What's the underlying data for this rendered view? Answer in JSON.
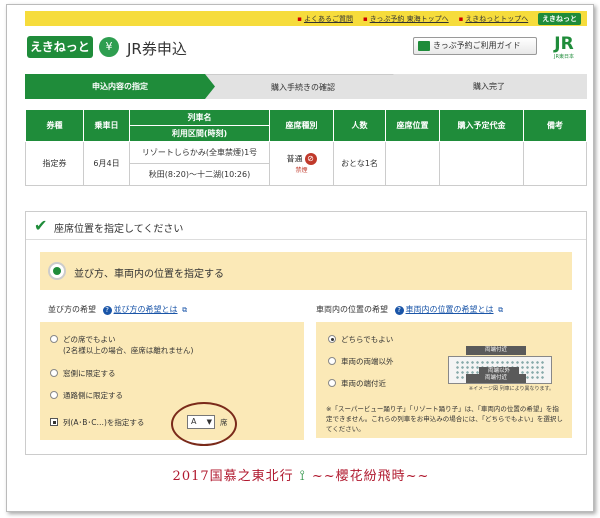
{
  "topbar": {
    "links": [
      "よくあるご質問",
      "きっぷ予約 東海トップへ",
      "えきねっとトップへ"
    ],
    "logo": "えきねっと"
  },
  "header": {
    "logo": "えきねっと",
    "title": "JR券申込",
    "guide_button": "きっぷ予約ご利用ガイド",
    "jr_logo": "JR",
    "jr_sub": "JR東日本"
  },
  "steps": [
    {
      "label": "申込内容の指定",
      "active": true
    },
    {
      "label": "購入手続きの確認",
      "active": false
    },
    {
      "label": "購入完了",
      "active": false
    }
  ],
  "table": {
    "headers": [
      "券種",
      "乗車日",
      "列車名",
      "利用区間(時刻)",
      "座席種別",
      "人数",
      "座席位置",
      "購入予定代金",
      "備考"
    ],
    "row": {
      "ticket_type": "指定券",
      "date": "6月4日",
      "train_name": "リゾートしらかみ(全車禁煙)1号",
      "section": "秋田(8:20)〜十二湖(10:26)",
      "seat_type": "普通",
      "smoking": "禁煙",
      "people": "おとな1名",
      "seat_position": "",
      "price": "",
      "remarks": ""
    }
  },
  "seat_section": {
    "title": "座席位置を指定してください",
    "option_label": "並び方、車両内の位置を指定する",
    "left": {
      "title": "並び方の希望",
      "link": "並び方の希望とは",
      "options": [
        {
          "label": "どの席でもよい",
          "sub": "(2名様以上の場合、座席は離れません)",
          "selected": false
        },
        {
          "label": "窓側に限定する",
          "selected": false
        },
        {
          "label": "通路側に限定する",
          "selected": false
        }
      ],
      "position_label": "列(A･B･C…)を指定する",
      "position_value": "A",
      "seat_suffix": "席"
    },
    "right": {
      "title": "車両内の位置の希望",
      "link": "車両内の位置の希望とは",
      "options": [
        {
          "label": "どちらでもよい",
          "selected": true
        },
        {
          "label": "車両の両端以外",
          "selected": false
        },
        {
          "label": "車両の端付近",
          "selected": false
        }
      ],
      "diagram": {
        "top": "両端付近",
        "middle": "両端以外",
        "bottom": "両端付近",
        "note": "※イメージ図 列車により異なります。"
      },
      "note": "※「スーパービュー踊り子」「リゾート踊り子」は、「車両内の位置の希望」を指定できません。これらの列車をお申込みの場合には、「どちらでもよい」を選択してください。"
    }
  },
  "caption": {
    "left": "2017国慕之東北行",
    "right": "~~櫻花紛飛時~~"
  }
}
